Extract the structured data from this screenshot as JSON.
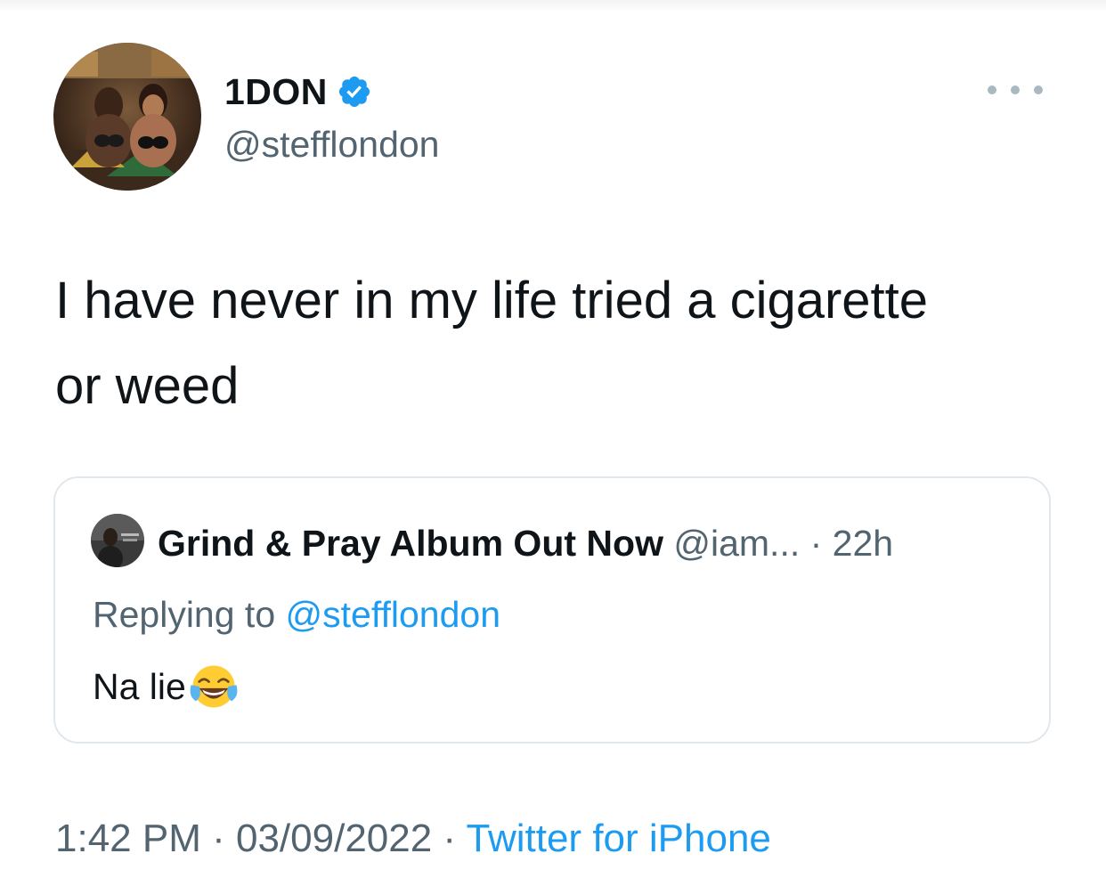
{
  "colors": {
    "text_primary": "#0f1419",
    "text_secondary": "#536471",
    "accent_blue": "#1d9bf0",
    "border": "#e1e8ed"
  },
  "tweet": {
    "author": {
      "display_name": "1DON",
      "handle": "@stefflondon",
      "verified": true,
      "avatar_icon": "avatar-photo"
    },
    "more_icon": "more-options-icon",
    "text_line1": "I have never in my life tried a cigarette",
    "text_line2": "or weed",
    "quoted": {
      "display_name": "Grind & Pray Album Out Now",
      "handle": "@iam...",
      "separator": " · ",
      "time": "22h",
      "replying_prefix": "Replying to ",
      "replying_to": "@stefflondon",
      "text": "Na lie",
      "emoji_icon": "face-with-tears-of-joy-icon"
    },
    "footer": {
      "time": "1:42 PM",
      "sep1": " · ",
      "date": "03/09/2022",
      "sep2": " · ",
      "source": "Twitter for iPhone"
    }
  }
}
